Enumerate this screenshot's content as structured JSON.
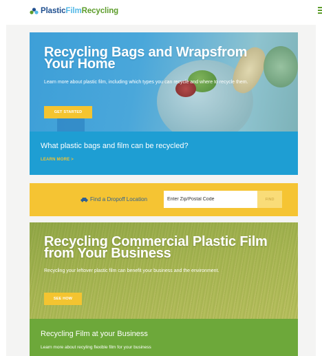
{
  "header": {
    "logo_plastic": "Plastic",
    "logo_film": "Film",
    "logo_recycling": "Recycling",
    "logo_icon": "recycle-hands-icon",
    "menu_icon": "hamburger-menu-icon"
  },
  "hero_home": {
    "title": "Recycling Bags and Wrapsfrom Your Home",
    "description": "Learn more about plastic film, including which types you can recycle and where to recycle them.",
    "button_label": "GET STARTED"
  },
  "banner_film": {
    "question": "What plastic bags and film can be recycled?",
    "link_label": "LEARN MORE >"
  },
  "dropoff": {
    "icon": "car-icon",
    "label": "Find a Dropoff Location",
    "zip_placeholder": "Enter Zip/Postal Code",
    "find_label": "FIND"
  },
  "hero_business": {
    "title": "Recycling Commercial Plastic Film from Your Business",
    "description": "Recycling your leftover plastic film can benefit your business and the environment.",
    "button_label": "SEE HOW"
  },
  "banner_business": {
    "title": "Recycling Film at your Business",
    "subtitle": "Learn more about recyling flexible film for your business"
  },
  "colors": {
    "brand_blue": "#1f4f8f",
    "brand_lightblue": "#54b8e6",
    "brand_green": "#5c9c2a",
    "accent_yellow": "#f4c430",
    "banner_blue": "#1e9ed3",
    "banner_green": "#6da83a"
  }
}
